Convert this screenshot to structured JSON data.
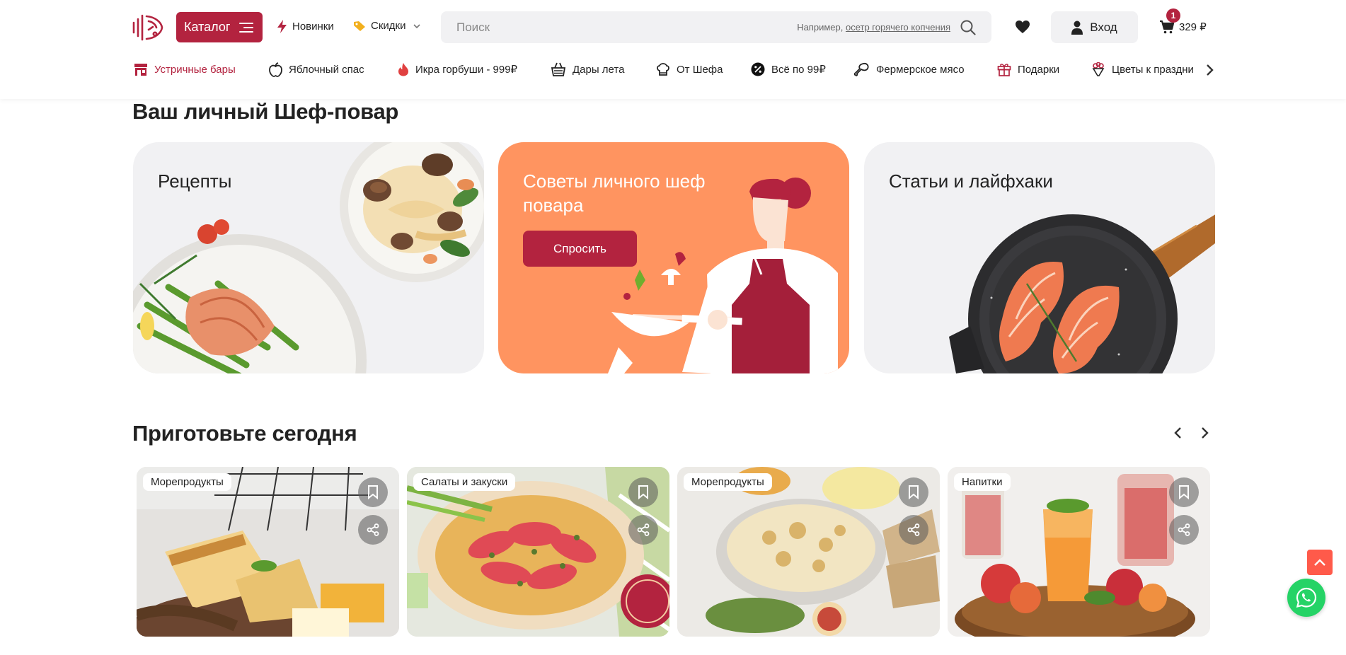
{
  "header": {
    "logo_icon": "brand-fish-logo-icon",
    "catalog_label": "Каталог",
    "novelties_label": "Новинки",
    "discounts_label": "Скидки",
    "search": {
      "placeholder": "Поиск",
      "hint_prefix": "Например, ",
      "hint_example": "осетр горячего копчения"
    },
    "login_label": "Вход",
    "cart": {
      "badge": "1",
      "total": "329 ₽"
    },
    "accent_color": "#b3233f"
  },
  "promo_nav": {
    "items": [
      {
        "label": "Устричные бары",
        "icon": "store-icon",
        "active": true
      },
      {
        "label": "Яблочный спас",
        "icon": "apple-icon"
      },
      {
        "label": "Икра горбуши - 999₽",
        "icon": "flame-icon"
      },
      {
        "label": "Дары лета",
        "icon": "basket-icon"
      },
      {
        "label": "От Шефа",
        "icon": "chef-hat-icon"
      },
      {
        "label": "Всё по 99₽",
        "icon": "percent-badge-icon"
      },
      {
        "label": "Фермерское мясо",
        "icon": "meat-leg-icon"
      },
      {
        "label": "Подарки",
        "icon": "gift-icon"
      },
      {
        "label": "Цветы к праздни",
        "icon": "flower-bouquet-icon"
      }
    ]
  },
  "chef_section": {
    "title": "Ваш личный Шеф-повар",
    "cards": [
      {
        "title": "Рецепты"
      },
      {
        "title": "Советы личного шеф повара",
        "button_label": "Спросить",
        "background": "#ff9460"
      },
      {
        "title": "Статьи и лайфхаки"
      }
    ]
  },
  "cook_today": {
    "title": "Приготовьте сегодня",
    "recipes": [
      {
        "tag": "Морепродукты"
      },
      {
        "tag": "Салаты и закуски"
      },
      {
        "tag": "Морепродукты"
      },
      {
        "tag": "Напитки"
      }
    ]
  }
}
